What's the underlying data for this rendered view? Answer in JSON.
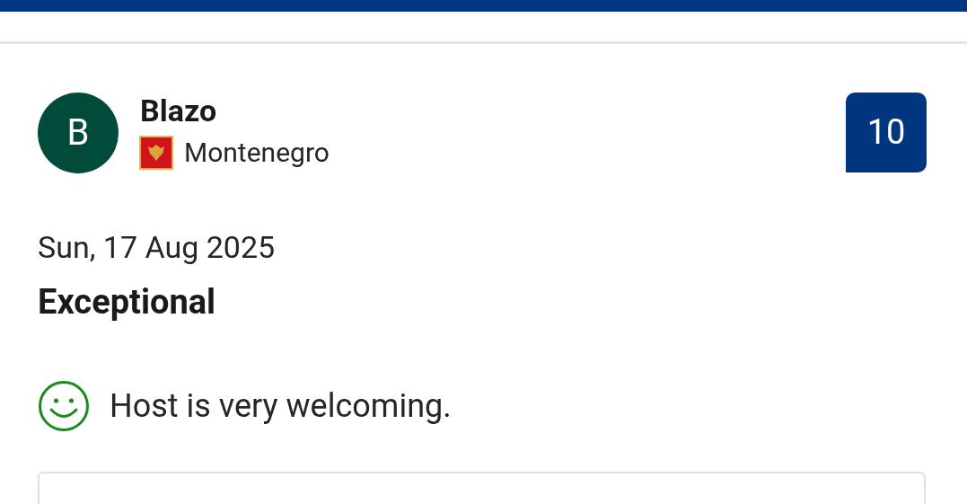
{
  "reviewer": {
    "initial": "B",
    "name": "Blazo",
    "country": "Montenegro"
  },
  "score": "10",
  "date": "Sun, 17 Aug 2025",
  "rating_label": "Exceptional",
  "positive_comment": "Host is very welcoming."
}
